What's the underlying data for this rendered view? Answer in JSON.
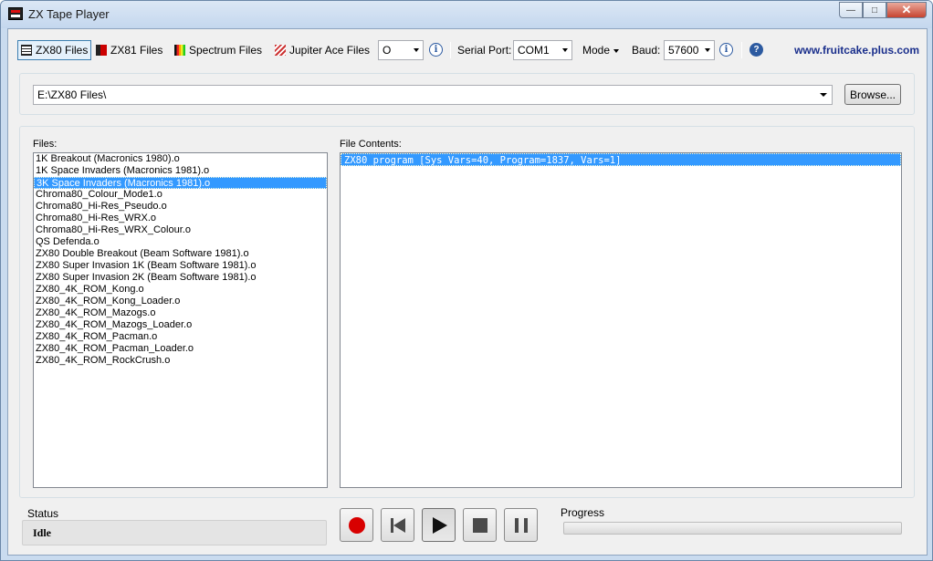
{
  "window": {
    "title": "ZX Tape Player",
    "minimize_icon": "minimize-icon",
    "maximize_icon": "maximize-icon",
    "close_icon": "close-icon"
  },
  "toolbar": {
    "tabs": [
      {
        "label": "ZX80 Files",
        "icon": "zx80-icon",
        "selected": true
      },
      {
        "label": "ZX81 Files",
        "icon": "zx81-icon",
        "selected": false
      },
      {
        "label": "Spectrum Files",
        "icon": "spectrum-icon",
        "selected": false
      },
      {
        "label": "Jupiter Ace Files",
        "icon": "jupiter-ace-icon",
        "selected": false
      }
    ],
    "extension_value": "O",
    "serial_port_label": "Serial Port:",
    "serial_port_value": "COM1",
    "mode_label": "Mode",
    "baud_label": "Baud:",
    "baud_value": "57600",
    "website_link": "www.fruitcake.plus.com"
  },
  "path": {
    "value": "E:\\ZX80 Files\\",
    "browse_label": "Browse..."
  },
  "files": {
    "label": "Files:",
    "selected_index": 2,
    "items": [
      "1K Breakout (Macronics 1980).o",
      "1K Space Invaders (Macronics 1981).o",
      "3K Space Invaders (Macronics 1981).o",
      "Chroma80_Colour_Mode1.o",
      "Chroma80_Hi-Res_Pseudo.o",
      "Chroma80_Hi-Res_WRX.o",
      "Chroma80_Hi-Res_WRX_Colour.o",
      "QS Defenda.o",
      "ZX80 Double Breakout (Beam Software 1981).o",
      "ZX80 Super Invasion 1K (Beam Software 1981).o",
      "ZX80 Super Invasion 2K (Beam Software 1981).o",
      "ZX80_4K_ROM_Kong.o",
      "ZX80_4K_ROM_Kong_Loader.o",
      "ZX80_4K_ROM_Mazogs.o",
      "ZX80_4K_ROM_Mazogs_Loader.o",
      "ZX80_4K_ROM_Pacman.o",
      "ZX80_4K_ROM_Pacman_Loader.o",
      "ZX80_4K_ROM_RockCrush.o"
    ]
  },
  "contents": {
    "label": "File Contents:",
    "items": [
      "ZX80 program [Sys Vars=40, Program=1837, Vars=1]"
    ]
  },
  "status": {
    "label": "Status",
    "value": "Idle"
  },
  "transport": {
    "record_icon": "record-icon",
    "rewind_icon": "skip-back-icon",
    "play_icon": "play-icon",
    "stop_icon": "stop-icon",
    "pause_icon": "pause-icon"
  },
  "progress": {
    "label": "Progress",
    "value": 0
  }
}
